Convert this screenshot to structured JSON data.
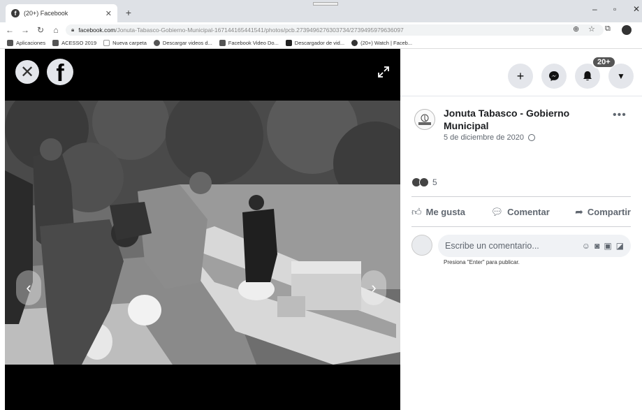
{
  "browser": {
    "tab_title": "(20+) Facebook",
    "tab_icon": "facebook-icon",
    "new_tab": "+",
    "url_host": "facebook.com",
    "url_path": "/Jonuta-Tabasco-Gobierno-Municipal-167144165441541/photos/pcb.2739496276303734/2739495979636097",
    "bookmarks": [
      "Aplicaciones",
      "ACESSO 2019",
      "Nueva carpeta",
      "Descargar videos d...",
      "Facebook Video Do...",
      "Descargador de vid...",
      "(20+) Watch | Faceb..."
    ]
  },
  "viewer": {
    "close_icon": "close-icon",
    "logo_icon": "facebook-logo-icon",
    "prev_icon": "chevron-left-icon",
    "next_icon": "chevron-right-icon",
    "expand_icon": "expand-icon"
  },
  "topbar": {
    "notifications_count": "20+"
  },
  "post": {
    "page_name": "Jonuta Tabasco - Gobierno Municipal",
    "date": "5 de diciembre de 2020",
    "reaction_count": "5",
    "like_label": "Me gusta",
    "comment_label": "Comentar",
    "share_label": "Compartir",
    "comment_placeholder": "Escribe un comentario...",
    "enter_hint": "Presiona \"Enter\" para publicar."
  }
}
